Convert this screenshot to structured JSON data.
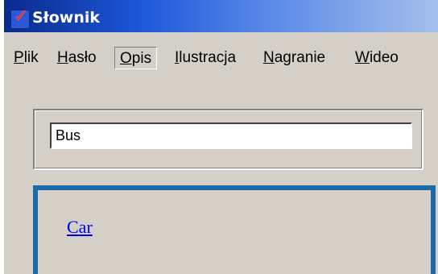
{
  "window": {
    "title": "Słownik"
  },
  "menu": {
    "items": [
      {
        "mnemonic": "P",
        "rest": "lik"
      },
      {
        "mnemonic": "H",
        "rest": "asło"
      },
      {
        "mnemonic": "O",
        "rest": "pis",
        "active": true
      },
      {
        "mnemonic": "I",
        "rest": "lustracja"
      },
      {
        "mnemonic": "N",
        "rest": "agranie"
      },
      {
        "mnemonic": "W",
        "rest": "ideo"
      }
    ]
  },
  "search": {
    "value": "Bus"
  },
  "result": {
    "link_text": "Car",
    "border_color": "#1c6aa8"
  },
  "colors": {
    "face": "#d4d0c8",
    "titlebar_start": "#0a2a8c",
    "link": "#0000ee"
  },
  "icons": {
    "app": "dictionary-checkmark-icon"
  }
}
